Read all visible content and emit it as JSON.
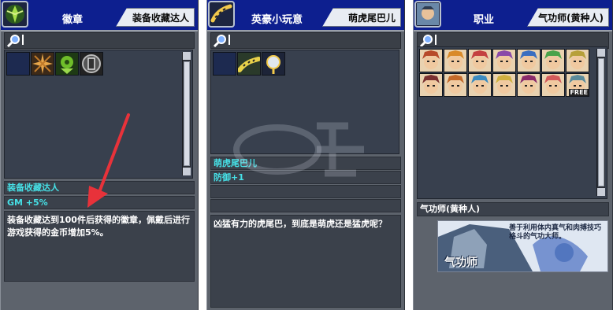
{
  "panels": [
    {
      "title": "徽章",
      "tab": "装备收藏达人",
      "item_name": "装备收藏达人",
      "stat": "GM +5%",
      "description": "装备收藏达到100件后获得的徽章，佩戴后进行游戏获得的金币增加5%。",
      "grid_icons": [
        "empty-slot",
        "star-burst-icon",
        "green-emblem-icon",
        "shield-badge-icon"
      ]
    },
    {
      "title": "英豪小玩意",
      "tab": "萌虎尾巴儿",
      "item_name": "萌虎尾巴儿",
      "stat": "防御+1",
      "description": "凶猛有力的虎尾巴，到底是萌虎还是猛虎呢？",
      "grid_icons": [
        "empty-slot",
        "tiger-tail-icon",
        "mirror-icon"
      ]
    },
    {
      "title": "职业",
      "tab": "气功师(黄种人)",
      "job_name": "气功师(黄种人)",
      "card_caption": "善于利用体内真气和肉搏技巧格斗的气功大师。",
      "card_title": "气功师",
      "free_badge": "FREE",
      "portraits": 14
    }
  ],
  "colors": {
    "header_blue": "#0d1f8f",
    "panel_gray": "#5d636c",
    "stat_cyan": "#46e0e6",
    "arrow_red": "#e8323a"
  }
}
